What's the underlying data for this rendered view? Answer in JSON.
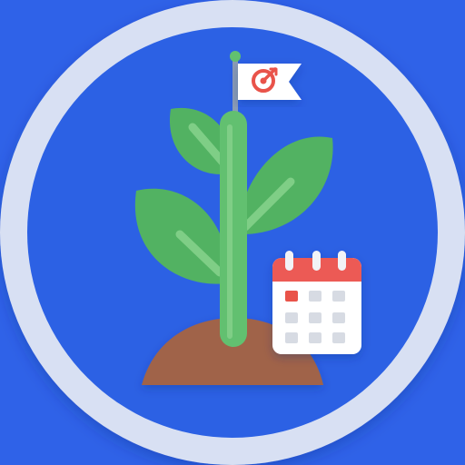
{
  "icon": {
    "subject": "growth-goal-app-icon",
    "elements": [
      "sprout",
      "goal-flag",
      "target-icon",
      "calendar"
    ]
  },
  "colors": {
    "background": "#2f62e8",
    "ring": "#d8e0f3",
    "disc": "#2c61e4",
    "stem": "#62c070",
    "leaf": "#52b262",
    "leaf_vein": "#7fce86",
    "soil": "#a0634a",
    "flag": "#ffffff",
    "flag_pole": "#8a9bb5",
    "target": "#e9534a",
    "calendar_header": "#ec5a55",
    "calendar_body": "#ffffff",
    "calendar_cell": "#d7dbe3",
    "calendar_highlight": "#e9534a",
    "calendar_ring": "#f2f3f6"
  }
}
